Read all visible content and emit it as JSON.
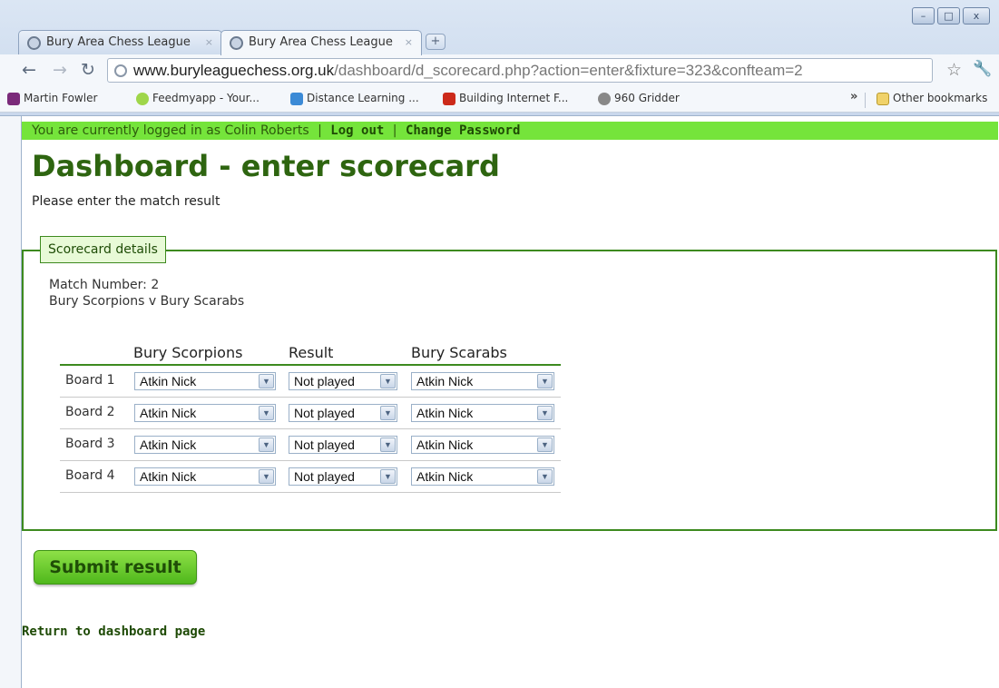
{
  "browser": {
    "tabs": [
      {
        "title": "Bury Area Chess League",
        "close": "×"
      },
      {
        "title": "Bury Area Chess League",
        "close": "×"
      }
    ],
    "new_tab": "+",
    "url_prefix": "www.",
    "url_host": "buryleaguechess.org.uk",
    "url_path": "/dashboard/d_scorecard.php?action=enter&fixture=323&confteam=2",
    "bookmarks": [
      {
        "label": "Martin Fowler",
        "icon": "fowler-icon",
        "color": "#7a2a7a"
      },
      {
        "label": "Feedmyapp - Your...",
        "icon": "feedmyapp-icon",
        "color": "#9fd64a"
      },
      {
        "label": "Distance Learning ...",
        "icon": "distance-learning-icon",
        "color": "#3b8ad6"
      },
      {
        "label": "Building Internet F...",
        "icon": "building-internet-icon",
        "color": "#cc2a1a"
      },
      {
        "label": "960 Gridder",
        "icon": "gridder-icon",
        "color": "#888888"
      }
    ],
    "more_bookmarks": "»",
    "other_bookmarks": "Other bookmarks"
  },
  "login": {
    "text": "You are currently logged in as Colin Roberts",
    "separator": "|",
    "logout": "Log out",
    "change_password": "Change Password"
  },
  "page": {
    "title": "Dashboard - enter scorecard",
    "subtitle": "Please enter the match result"
  },
  "scorecard": {
    "legend": "Scorecard details",
    "match_number": "Match Number: 2",
    "fixture": "Bury Scorpions v Bury Scarabs",
    "headers": {
      "home": "Bury Scorpions",
      "result": "Result",
      "away": "Bury Scarabs"
    },
    "boards": [
      {
        "label": "Board 1",
        "home": "Atkin Nick",
        "result": "Not played",
        "away": "Atkin Nick"
      },
      {
        "label": "Board 2",
        "home": "Atkin Nick",
        "result": "Not played",
        "away": "Atkin Nick"
      },
      {
        "label": "Board 3",
        "home": "Atkin Nick",
        "result": "Not played",
        "away": "Atkin Nick"
      },
      {
        "label": "Board 4",
        "home": "Atkin Nick",
        "result": "Not played",
        "away": "Atkin Nick"
      }
    ]
  },
  "actions": {
    "submit": "Submit result",
    "return": "Return to dashboard page"
  }
}
